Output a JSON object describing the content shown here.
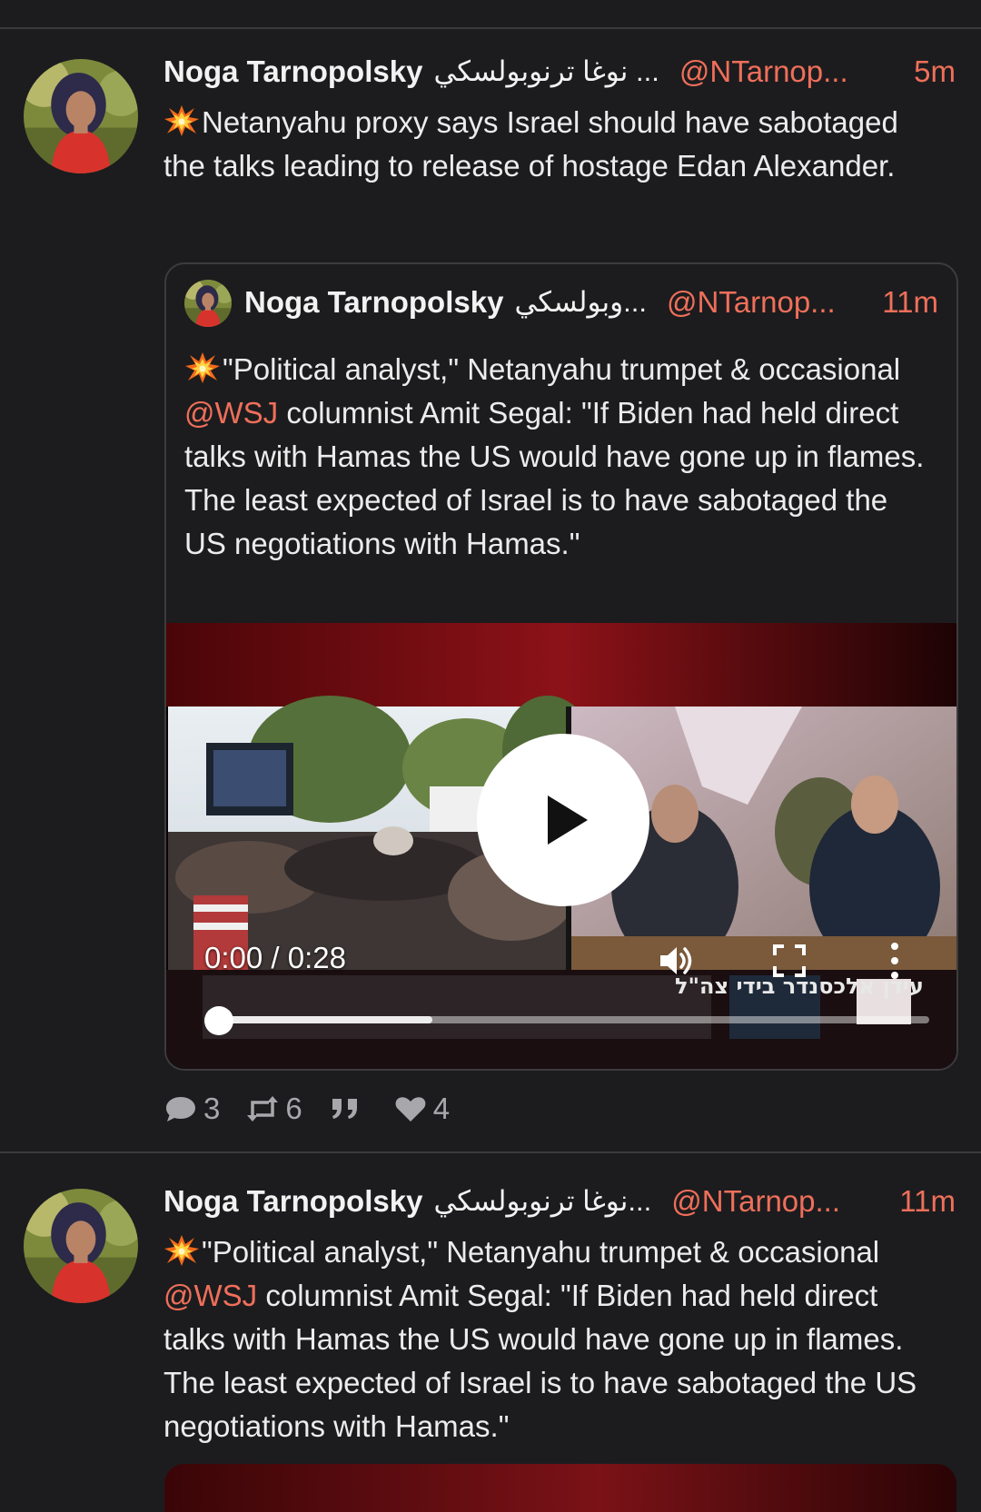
{
  "posts": [
    {
      "author": "Noga Tarnopolsky",
      "author_rtl": "... نوغا ترنوبولسكي",
      "handle": "@NTarnop...",
      "time": "5m",
      "text": "Netanyahu proxy says Israel should have sabotaged the talks leading to release of hostage Edan Alexander.",
      "quote": {
        "author": "Noga Tarnopolsky",
        "author_rtl": "...وبولسكي",
        "handle": "@NTarnop...",
        "time": "11m",
        "text_before": "\"Political analyst,\" Netanyahu trumpet & occasional ",
        "mention": "@WSJ",
        "text_after": " columnist Amit Segal: \"If Biden had held direct talks with Hamas the US would have gone up in flames. The least expected of Israel is to have sabotaged the US negotiations with Hamas.\"",
        "video": {
          "time_display": "0:00 / 0:28",
          "progress": 0,
          "buffered": 0.3,
          "chyron": "עידן אלכסנדר בידי צה\"ל"
        }
      },
      "stats": {
        "replies": "3",
        "reposts": "6",
        "likes": "4"
      }
    },
    {
      "author": "Noga Tarnopolsky",
      "author_rtl": "...نوغا ترنوبولسكي",
      "handle": "@NTarnop...",
      "time": "11m",
      "text_before": "\"Political analyst,\" Netanyahu trumpet & occasional ",
      "mention": "@WSJ",
      "text_after": " columnist Amit Segal: \"If Biden had held direct talks with Hamas the US would have gone up in flames. The least expected of Israel is to have sabotaged the US negotiations with Hamas.\""
    }
  ],
  "icons": [
    "collision-emoji-icon",
    "reply-icon",
    "repost-icon",
    "quote-icon",
    "heart-icon",
    "play-icon",
    "volume-icon",
    "fullscreen-icon",
    "more-vertical-icon"
  ],
  "colors": {
    "background": "#1c1c1e",
    "accent": "#ef6f5a",
    "text": "#ececec",
    "muted": "#a8a8ac",
    "divider": "#3a3a3c"
  }
}
